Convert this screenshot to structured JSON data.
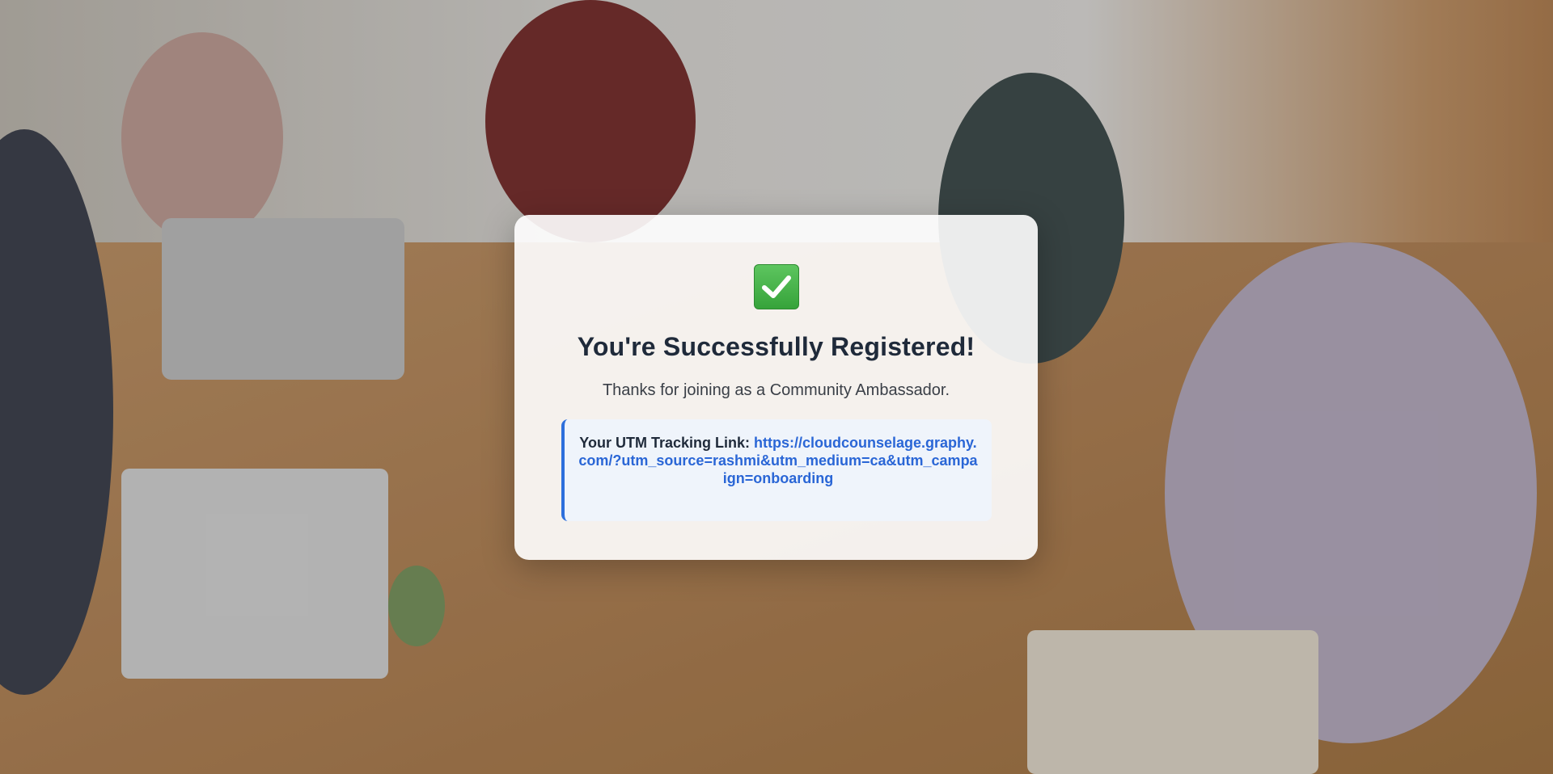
{
  "modal": {
    "icon": "check-mark-icon",
    "title": "You're Successfully Registered!",
    "subtitle": "Thanks for joining as a Community Ambassador.",
    "utm_label": "Your UTM Tracking Link:",
    "utm_link": "https://cloudcounselage.graphy.com/?utm_source=rashmi&utm_medium=ca&utm_campaign=onboarding"
  },
  "colors": {
    "accent": "#2a66d6",
    "success": "#36a33a",
    "title": "#1f2a3a"
  }
}
